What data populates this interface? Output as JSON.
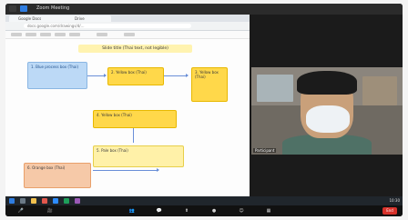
{
  "window": {
    "title": "Zoom Meeting"
  },
  "browser": {
    "tabs": [
      "Google Docs",
      "Drive"
    ],
    "url": "docs.google.com/drawings/d/..."
  },
  "slide": {
    "title": "Slide title (Thai text, not legible)",
    "boxes": [
      {
        "text": "1. Blue process box (Thai)"
      },
      {
        "text": "2. Yellow box (Thai)"
      },
      {
        "text": "3. Yellow box (Thai)"
      },
      {
        "text": "4. Yellow box (Thai)"
      },
      {
        "text": "5. Pale box (Thai)"
      },
      {
        "text": "6. Orange box (Thai)"
      }
    ]
  },
  "participant": {
    "name": "Participant"
  },
  "taskbar": {
    "time": "10:30"
  },
  "controls": {
    "end_label": "End"
  },
  "colors": {
    "blue_box": "#bcd9f6",
    "yellow_box": "#ffd84a",
    "orange_box": "#f6c9a8",
    "end_red": "#d8322b"
  }
}
